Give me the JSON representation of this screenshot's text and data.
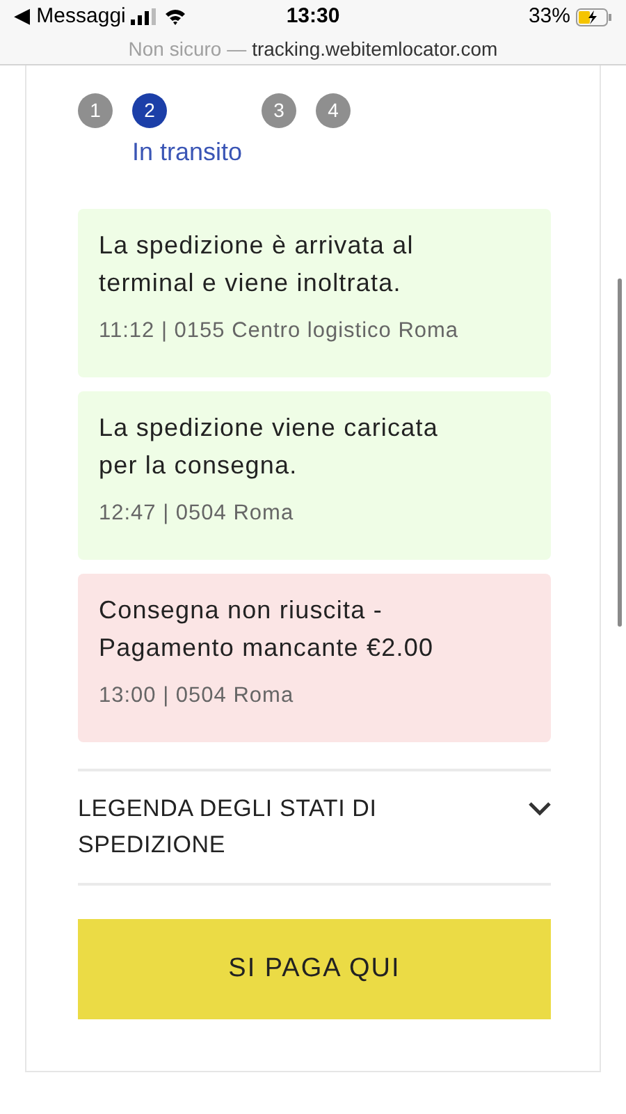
{
  "status_bar": {
    "back_label": "◀ Messaggi",
    "time": "13:30",
    "battery": "33%"
  },
  "url_bar": {
    "security": "Non sicuro —",
    "domain": "tracking.webitemlocator.com"
  },
  "steps": [
    {
      "number": "1",
      "selected": false
    },
    {
      "number": "2",
      "selected": true,
      "label": "In transito"
    },
    {
      "number": "3",
      "selected": false
    },
    {
      "number": "4",
      "selected": false
    }
  ],
  "events": [
    {
      "kind": "ok",
      "message": "La spedizione è arrivata al terminal e viene inoltrata.",
      "detail": "11:12 | 0155 Centro logistico Roma"
    },
    {
      "kind": "ok",
      "message": "La spedizione viene caricata per la consegna.",
      "detail": "12:47 | 0504 Roma"
    },
    {
      "kind": "failed",
      "message": "Consegna non riuscita - Pagamento mancante €2.00",
      "detail": "13:00 | 0504 Roma"
    }
  ],
  "legend": {
    "title": "LEGENDA DEGLI STATI DI SPEDIZIONE",
    "expanded": false
  },
  "pay_button": "SI PAGA QUI"
}
